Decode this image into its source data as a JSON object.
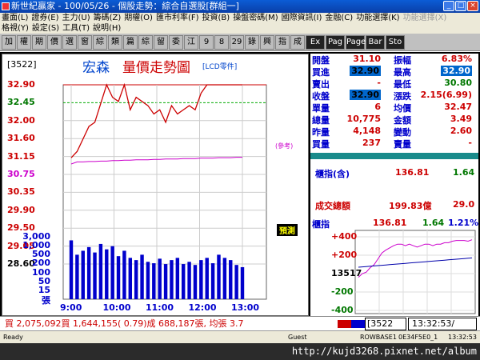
{
  "window": {
    "title": "新世紀贏家 - 100/05/26 - 個股走勢：綜合自選股[群組一]",
    "minimize": "_",
    "maximize": "□",
    "close": "×"
  },
  "menu": {
    "row1": [
      "畫面(L)",
      "證券(E)",
      "主力(U)",
      "籌碼(Z)",
      "期權(O)",
      "匯市利率(F)",
      "投資(B)",
      "操盤密碼(M)",
      "國際資訊(I)",
      "金融(C)",
      "功能選擇(K)",
      "功能選擇(X)"
    ],
    "row2": [
      "格視(Y)",
      "設定(S)",
      "工具(T)",
      "說明(H)"
    ]
  },
  "toolbar": [
    "加",
    "權",
    "期",
    "價",
    "選",
    "窗",
    "綜",
    "類",
    "篇",
    "綜",
    "留",
    "委",
    "江",
    "9",
    "8",
    "29",
    "錄",
    "興",
    "指",
    "成",
    "Ex",
    "Pag",
    "Page",
    "Bar",
    "Sto"
  ],
  "chart": {
    "stock_code": "[3522]",
    "stock_name": "宏森",
    "title": "量價走勢圖",
    "category": "[LCD零件]",
    "price_ticks": [
      "32.90",
      "32.45",
      "32.00",
      "31.60",
      "31.15",
      "30.75",
      "30.35",
      "29.90",
      "29.50",
      "29.05",
      "28.60"
    ],
    "volume_ticks": [
      "3,000",
      "1,000",
      "500",
      "200",
      "100",
      "50",
      "15",
      "張"
    ],
    "time_ticks": [
      "9:00",
      "10:00",
      "11:00",
      "12:00",
      "13:00"
    ],
    "ref_note": "(參考)",
    "predict_label": "預測"
  },
  "chart_data": {
    "type": "line",
    "x": [
      "9:00",
      "9:05",
      "9:10",
      "9:15",
      "9:20",
      "9:30",
      "9:40",
      "9:50",
      "10:00",
      "10:10",
      "10:20",
      "10:30",
      "10:40",
      "10:50",
      "11:00",
      "11:10",
      "11:20",
      "11:30",
      "11:40",
      "11:50",
      "12:00",
      "12:10",
      "12:20",
      "12:30",
      "12:40",
      "12:50",
      "13:00",
      "13:10",
      "13:20",
      "13:30"
    ],
    "series": [
      {
        "values": [
          31.15,
          31.3,
          31.6,
          31.9,
          32.0,
          32.45,
          32.9,
          32.6,
          32.5,
          32.9,
          32.3,
          32.6,
          32.5,
          32.4,
          32.2,
          32.3,
          32.0,
          32.4,
          32.2,
          32.3,
          32.4,
          32.3,
          32.7,
          32.9,
          32.9,
          32.9,
          32.9,
          32.9,
          32.9,
          32.9
        ]
      },
      {
        "values": [
          31.0,
          31.05,
          31.05,
          31.06,
          31.06,
          31.07,
          31.07,
          31.08,
          31.08,
          31.09,
          31.09,
          31.1,
          31.1,
          31.1,
          31.11,
          31.11,
          31.12,
          31.12,
          31.12,
          31.13,
          31.13,
          31.13,
          31.14,
          31.14,
          31.14,
          31.15,
          31.15,
          31.15,
          31.16,
          31.16
        ]
      }
    ],
    "volume": [
      1900,
      300,
      500,
      800,
      400,
      1200,
      600,
      900,
      250,
      500,
      200,
      150,
      300,
      120,
      100,
      180,
      90,
      150,
      200,
      90,
      120,
      80,
      150,
      200,
      100,
      300,
      200,
      150,
      80,
      60
    ],
    "ylim": [
      28.6,
      32.9
    ]
  },
  "quote": {
    "rows": [
      {
        "l1": "開盤",
        "v1": "31.10",
        "l2": "振幅",
        "v2": "6.83%"
      },
      {
        "l1": "買進",
        "v1": "32.90",
        "l2": "最高",
        "v2": "32.90"
      },
      {
        "l1": "賣出",
        "v1": "-",
        "l2": "最低",
        "v2": "30.80"
      },
      {
        "l1": "收盤",
        "v1": "32.90",
        "l2": "漲跌",
        "v2": "2.15(6.99)"
      },
      {
        "l1": "單量",
        "v1": "6",
        "l2": "均價",
        "v2": "32.47"
      },
      {
        "l1": "總量",
        "v1": "10,775",
        "l2": "金額",
        "v2": "3.49"
      },
      {
        "l1": "昨量",
        "v1": "4,148",
        "l2": "變動",
        "v2": "2.60"
      },
      {
        "l1": "買量",
        "v1": "237",
        "l2": "賣量",
        "v2": "-"
      }
    ]
  },
  "index_summary": {
    "label1": "櫃指(含)",
    "value1": "136.81",
    "change1": "1.64",
    "label2": "成交總額",
    "value2": "199.83億",
    "change2": "29.0"
  },
  "mini_chart": {
    "label": "櫃指",
    "value": "136.81",
    "change": "1.64",
    "pct": "1.21%",
    "ticks": [
      "+400",
      "+200",
      "13517",
      "-200",
      "-400"
    ],
    "line": [
      0.55,
      0.5,
      0.48,
      0.42,
      0.38,
      0.3,
      0.22,
      0.18,
      0.15,
      0.12,
      0.1,
      0.1,
      0.12,
      0.1,
      0.12,
      0.14,
      0.12,
      0.1,
      0.1,
      0.12,
      0.1,
      0.1,
      0.08,
      0.08,
      0.06,
      0.05,
      0.05,
      0.05,
      0.06,
      0.04
    ]
  },
  "footer": {
    "summary": "買 2,075,092買 1,644,155( 0.79)成 688,187張, 均張 3.7",
    "code": "[3522",
    "time": "13:32:53/"
  },
  "status": {
    "ready": "Ready",
    "guest": "Guest",
    "row": "ROWBASE1",
    "code": "0E34F5E0_1",
    "time": "13:32:53"
  },
  "watermark": "http://kujd3268.pixnet.net/album",
  "colors": {
    "price_line": "#cc0000",
    "ref_line": "#cc00cc",
    "volume": "#0000cc",
    "index_line": "#cc00cc"
  }
}
